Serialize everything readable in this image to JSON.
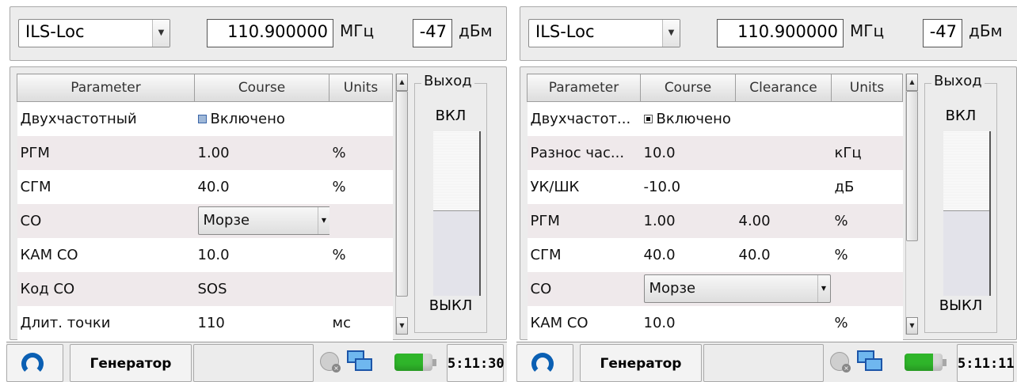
{
  "left": {
    "mode_select": "ILS-Loc",
    "frequency": "110.900000",
    "frequency_unit": "МГц",
    "level": "-47",
    "level_unit": "дБм",
    "table": {
      "headers": [
        "Parameter",
        "Course",
        "Units"
      ],
      "rows": [
        {
          "param": "Двухчастотный",
          "course": "Включено",
          "units": ""
        },
        {
          "param": "РГМ",
          "course": "1.00",
          "units": "%"
        },
        {
          "param": "СГМ",
          "course": "40.0",
          "units": "%"
        },
        {
          "param": "СО",
          "course": "Морзе",
          "units": ""
        },
        {
          "param": "КАМ СО",
          "course": "10.0",
          "units": "%"
        },
        {
          "param": "Код СО",
          "course": "SOS",
          "units": ""
        },
        {
          "param": "Длит. точки",
          "course": "110",
          "units": "мс"
        }
      ]
    },
    "output": {
      "legend": "Выход",
      "on_label": "ВКЛ",
      "off_label": "ВЫКЛ"
    },
    "taskbar": {
      "app_label": "Генератор",
      "clock": "5:11:30"
    }
  },
  "right": {
    "mode_select": "ILS-Loc",
    "frequency": "110.900000",
    "frequency_unit": "МГц",
    "level": "-47",
    "level_unit": "дБм",
    "table": {
      "headers": [
        "Parameter",
        "Course",
        "Clearance",
        "Units"
      ],
      "rows": [
        {
          "param": "Двухчастот...",
          "course": "Включено",
          "clearance": "",
          "units": ""
        },
        {
          "param": "Разнос час...",
          "course": "10.0",
          "clearance": "",
          "units": "кГц"
        },
        {
          "param": "УК/ШК",
          "course": "-10.0",
          "clearance": "",
          "units": "дБ"
        },
        {
          "param": "РГМ",
          "course": "1.00",
          "clearance": "4.00",
          "units": "%"
        },
        {
          "param": "СГМ",
          "course": "40.0",
          "clearance": "40.0",
          "units": "%"
        },
        {
          "param": "СО",
          "course": "Морзе",
          "clearance": "",
          "units": ""
        },
        {
          "param": "КАМ СО",
          "course": "10.0",
          "clearance": "",
          "units": "%"
        }
      ]
    },
    "output": {
      "legend": "Выход",
      "on_label": "ВКЛ",
      "off_label": "ВЫКЛ"
    },
    "taskbar": {
      "app_label": "Генератор",
      "clock": "5:11:11"
    }
  }
}
